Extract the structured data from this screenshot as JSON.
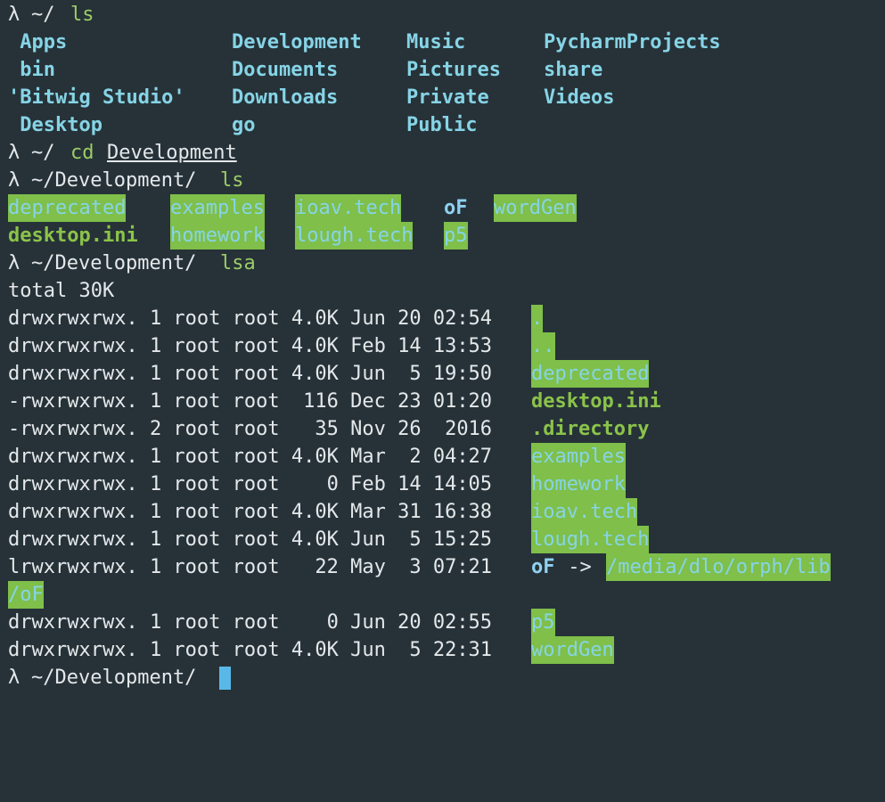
{
  "prompt_symbol": "λ",
  "blocks": {
    "ls_home": {
      "cwd": "~/",
      "command": "ls",
      "col1": [
        " Apps",
        " bin",
        "'Bitwig Studio'",
        " Desktop"
      ],
      "col2": [
        "Development",
        "Documents",
        "Downloads",
        "go"
      ],
      "col3": [
        "Music",
        "Pictures",
        "Private",
        "Public"
      ],
      "col4": [
        "PycharmProjects",
        "share",
        "Videos"
      ]
    },
    "cd": {
      "cwd": "~/",
      "command": "cd",
      "argument": "Development"
    },
    "ls_dev": {
      "cwd": "~/Development/",
      "command": "ls",
      "row1": [
        "deprecated",
        "examples",
        "ioav.tech",
        "oF",
        "wordGen"
      ],
      "row2": [
        "desktop.ini",
        "homework",
        "lough.tech",
        "p5"
      ]
    },
    "lsa": {
      "cwd": "~/Development/",
      "command": "lsa",
      "total": "total 30K",
      "rows": [
        {
          "meta": "drwxrwxrwx. 1 root root 4.0K Jun 20 02:54 ",
          "name": "."
        },
        {
          "meta": "drwxrwxrwx. 1 root root 4.0K Feb 14 13:53 ",
          "name": ".."
        },
        {
          "meta": "drwxrwxrwx. 1 root root 4.0K Jun  5 19:50 ",
          "name": "deprecated"
        },
        {
          "meta": "-rwxrwxrwx. 1 root root  116 Dec 23 01:20 ",
          "name": "desktop.ini"
        },
        {
          "meta": "-rwxrwxrwx. 2 root root   35 Nov 26  2016 ",
          "name": ".directory"
        },
        {
          "meta": "drwxrwxrwx. 1 root root 4.0K Mar  2 04:27 ",
          "name": "examples"
        },
        {
          "meta": "drwxrwxrwx. 1 root root    0 Feb 14 14:05 ",
          "name": "homework"
        },
        {
          "meta": "drwxrwxrwx. 1 root root 4.0K Mar 31 16:38 ",
          "name": "ioav.tech"
        },
        {
          "meta": "drwxrwxrwx. 1 root root 4.0K Jun  5 15:25 ",
          "name": "lough.tech"
        },
        {
          "meta": "lrwxrwxrwx. 1 root root   22 May  3 07:21 ",
          "name": "oF",
          "arrow": " -> ",
          "target1": "/media/dlo/orph/lib",
          "target2": "/oF"
        },
        {
          "meta": "drwxrwxrwx. 1 root root    0 Jun 20 02:55 ",
          "name": "p5"
        },
        {
          "meta": "drwxrwxrwx. 1 root root 4.0K Jun  5 22:31 ",
          "name": "wordGen"
        }
      ]
    },
    "final_prompt": {
      "cwd": "~/Development/"
    }
  }
}
